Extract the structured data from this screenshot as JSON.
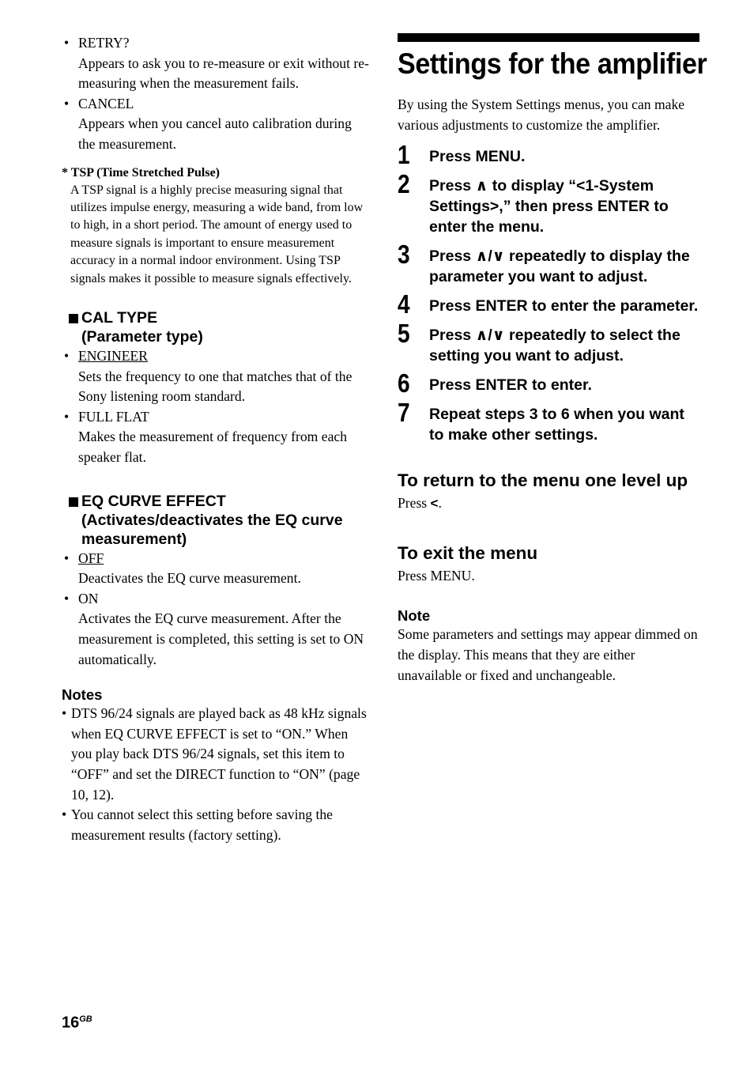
{
  "document": {
    "page_number": "16",
    "page_suffix": "GB"
  },
  "left_column": {
    "message_list": [
      {
        "bullet": "•",
        "term": "RETRY?",
        "description": "Appears to ask you to re-measure or exit without re-measuring when the measurement fails."
      },
      {
        "bullet": "•",
        "term": "CANCEL",
        "description": "Appears when you cancel auto calibration during the measurement."
      }
    ],
    "footnote": {
      "marker": "*",
      "title": "TSP (Time Stretched Pulse)",
      "body": "A TSP signal is a highly precise measuring signal that utilizes impulse energy, measuring a wide band, from low to high, in a short period. The amount of energy used to measure signals is important to ensure measurement accuracy in a normal indoor environment. Using TSP signals makes it possible to measure signals effectively."
    },
    "sections": [
      {
        "square": "■",
        "heading_line1": "CAL TYPE",
        "heading_line2": "(Parameter type)",
        "options": [
          {
            "bullet": "•",
            "term": "ENGINEER",
            "underlined": true,
            "description": "Sets the frequency to one that matches that of the Sony listening room standard."
          },
          {
            "bullet": "•",
            "term": "FULL FLAT",
            "underlined": false,
            "description": "Makes the measurement of frequency from each speaker flat."
          }
        ]
      },
      {
        "square": "■",
        "heading_line1": "EQ CURVE EFFECT",
        "heading_line2": "(Activates/deactivates the EQ curve measurement)",
        "options": [
          {
            "bullet": "•",
            "term": "OFF",
            "underlined": true,
            "description": "Deactivates the EQ curve measurement."
          },
          {
            "bullet": "•",
            "term": "ON",
            "underlined": false,
            "description": "Activates the EQ curve measurement. After the measurement is completed, this setting is set to ON automatically."
          }
        ]
      }
    ],
    "notes": {
      "heading": "Notes",
      "items": [
        {
          "bullet": "•",
          "text": "DTS 96/24 signals are played back as 48 kHz signals when EQ CURVE EFFECT is set to “ON.” When you play back DTS 96/24 signals, set this item to “OFF” and set the DIRECT function to “ON” (page 10, 12)."
        },
        {
          "bullet": "•",
          "text": "You cannot select this setting before saving the measurement results (factory setting)."
        }
      ]
    }
  },
  "right_column": {
    "chapter_title": "Settings for the amplifier",
    "intro": "By using the System Settings menus, you can make various adjustments to customize the amplifier.",
    "steps": [
      {
        "number": "1",
        "text": "Press MENU."
      },
      {
        "number": "2",
        "text": "Press ∧ to display “<1-System Settings>,” then press ENTER to enter the menu."
      },
      {
        "number": "3",
        "text": "Press ∧/∨ repeatedly to display the parameter you want to adjust."
      },
      {
        "number": "4",
        "text": "Press ENTER to enter the parameter."
      },
      {
        "number": "5",
        "text": "Press ∧/∨ repeatedly to select the setting you want to adjust."
      },
      {
        "number": "6",
        "text": "Press ENTER to enter."
      },
      {
        "number": "7",
        "text": "Repeat steps 3 to 6 when you want to make other settings."
      }
    ],
    "return_section": {
      "heading": "To return to the menu one level up",
      "body_prefix": "Press ",
      "body_glyph": "<",
      "body_suffix": "."
    },
    "exit_section": {
      "heading": "To exit the menu",
      "body": "Press MENU."
    },
    "note": {
      "heading": "Note",
      "body": "Some parameters and settings may appear dimmed on the display. This means that they are either unavailable or fixed and unchangeable."
    }
  },
  "colors": {
    "text": "#000000",
    "background": "#ffffff",
    "bar": "#000000"
  }
}
